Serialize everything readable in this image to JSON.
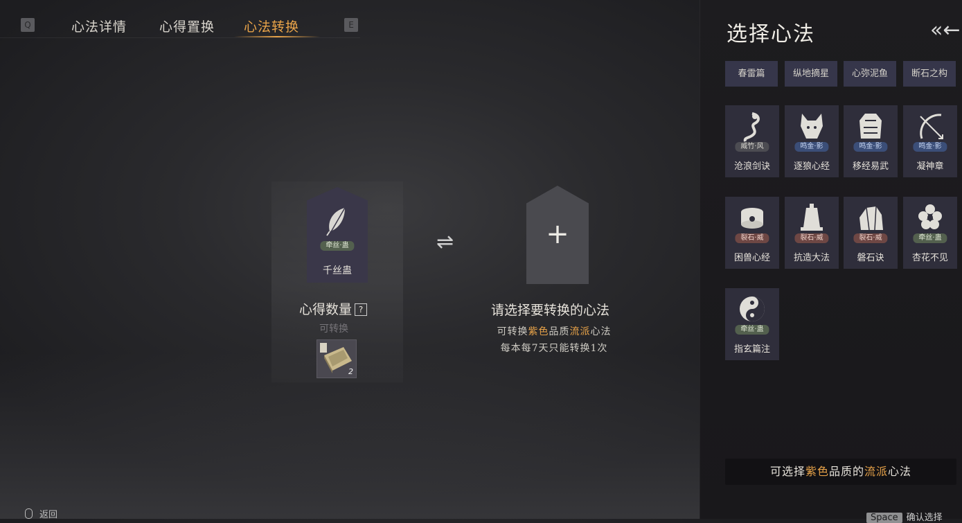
{
  "tabs": {
    "prev_key": "Q",
    "next_key": "E",
    "items": [
      "心法详情",
      "心得置换",
      "心法转换"
    ],
    "active_index": 2
  },
  "source_card": {
    "name": "千丝蛊",
    "tag": "牵丝·蛊",
    "tag_color": "green",
    "icon": "feather-icon"
  },
  "insight": {
    "label": "心得数量",
    "help": "?",
    "status": "可转换",
    "item_icon": "book-icon",
    "item_count": "2"
  },
  "swap_icon": "⇌",
  "target": {
    "plus": "+",
    "title": "请选择要转换的心法",
    "line1_prefix": "可转换",
    "line1_quality": "紫色",
    "line1_mid": "品质",
    "line1_school": "流派",
    "line1_suffix": "心法",
    "line2": "每本每7天只能转换1次"
  },
  "panel": {
    "title": "选择心法",
    "collapse_icon": "«←",
    "filters": [
      "春雷篇",
      "纵地摘星",
      "心弥泥鱼",
      "断石之构"
    ],
    "cards": [
      {
        "name": "沧浪剑诀",
        "tag": "威竹·风",
        "tag_color": "dark",
        "icon": "dragon-icon"
      },
      {
        "name": "逐狼心经",
        "tag": "鸣金·影",
        "tag_color": "blue",
        "icon": "wolf-icon"
      },
      {
        "name": "移经易武",
        "tag": "鸣金·影",
        "tag_color": "blue",
        "icon": "armor-icon"
      },
      {
        "name": "凝神章",
        "tag": "鸣金·影",
        "tag_color": "blue",
        "icon": "bow-icon"
      },
      {
        "name": "困兽心经",
        "tag": "裂石·威",
        "tag_color": "red",
        "icon": "drum-icon"
      },
      {
        "name": "抗造大法",
        "tag": "裂石·威",
        "tag_color": "red",
        "icon": "bell-icon"
      },
      {
        "name": "磐石诀",
        "tag": "裂石·威",
        "tag_color": "red",
        "icon": "rock-icon"
      },
      {
        "name": "杏花不见",
        "tag": "牵丝·蛊",
        "tag_color": "green",
        "icon": "flower-icon"
      },
      {
        "name": "指玄篇注",
        "tag": "牵丝·蛊",
        "tag_color": "green",
        "icon": "yinyang-icon"
      }
    ],
    "hint_prefix": "可选择",
    "hint_quality": "紫色",
    "hint_mid": "品质的",
    "hint_school": "流派",
    "hint_suffix": "心法",
    "confirm_key": "Space",
    "confirm_label": "确认选择"
  },
  "footer": {
    "back_label": "返回"
  },
  "colors": {
    "accent": "#e8a349",
    "panel_bg": "#1b1a1d",
    "card_bg": "#2f2e3b"
  }
}
